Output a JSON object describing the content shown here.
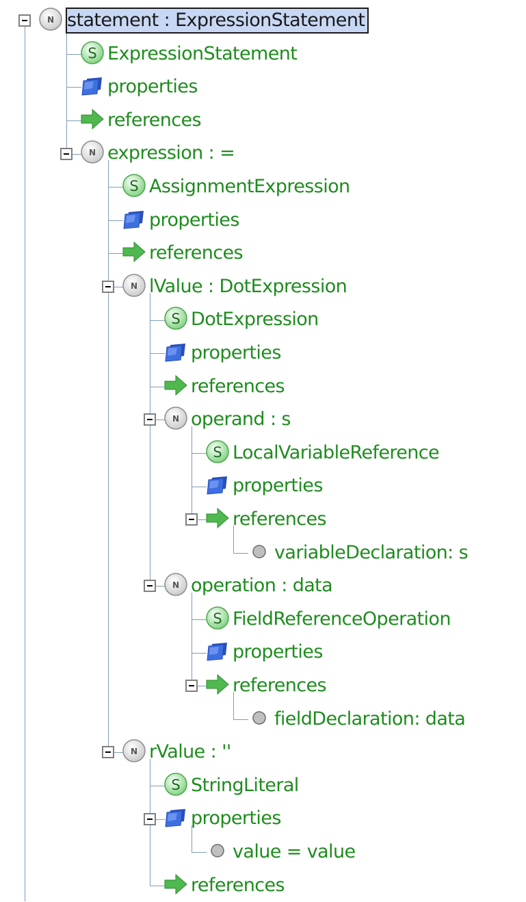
{
  "tree": {
    "nodes": [
      {
        "label": "statement : ExpressionStatement",
        "icon": "node-icon",
        "depth": 0,
        "expanded": true,
        "selected": true
      },
      {
        "label": "ExpressionStatement",
        "icon": "concept-icon",
        "depth": 1
      },
      {
        "label": "properties",
        "icon": "properties-icon",
        "depth": 1
      },
      {
        "label": "references",
        "icon": "references-arrow-icon",
        "depth": 1
      },
      {
        "label": "expression : =",
        "icon": "node-icon",
        "depth": 1,
        "expanded": true
      },
      {
        "label": "AssignmentExpression",
        "icon": "concept-icon",
        "depth": 2
      },
      {
        "label": "properties",
        "icon": "properties-icon",
        "depth": 2
      },
      {
        "label": "references",
        "icon": "references-arrow-icon",
        "depth": 2
      },
      {
        "label": "lValue : DotExpression",
        "icon": "node-icon",
        "depth": 2,
        "expanded": true
      },
      {
        "label": "DotExpression",
        "icon": "concept-icon",
        "depth": 3
      },
      {
        "label": "properties",
        "icon": "properties-icon",
        "depth": 3
      },
      {
        "label": "references",
        "icon": "references-arrow-icon",
        "depth": 3
      },
      {
        "label": "operand : s",
        "icon": "node-icon",
        "depth": 3,
        "expanded": true
      },
      {
        "label": "LocalVariableReference",
        "icon": "concept-icon",
        "depth": 4
      },
      {
        "label": "properties",
        "icon": "properties-icon",
        "depth": 4
      },
      {
        "label": "references",
        "icon": "references-arrow-icon",
        "depth": 4,
        "expanded": true
      },
      {
        "label": "variableDeclaration: s",
        "icon": "bullet-icon",
        "depth": 5
      },
      {
        "label": "operation : data",
        "icon": "node-icon",
        "depth": 3,
        "expanded": true
      },
      {
        "label": "FieldReferenceOperation",
        "icon": "concept-icon",
        "depth": 4
      },
      {
        "label": "properties",
        "icon": "properties-icon",
        "depth": 4
      },
      {
        "label": "references",
        "icon": "references-arrow-icon",
        "depth": 4,
        "expanded": true
      },
      {
        "label": "fieldDeclaration: data",
        "icon": "bullet-icon",
        "depth": 5
      },
      {
        "label": "rValue : ''",
        "icon": "node-icon",
        "depth": 2,
        "expanded": true
      },
      {
        "label": "StringLiteral",
        "icon": "concept-icon",
        "depth": 3
      },
      {
        "label": "properties",
        "icon": "properties-icon",
        "depth": 3,
        "expanded": true
      },
      {
        "label": "value = value",
        "icon": "bullet-icon",
        "depth": 4
      },
      {
        "label": "references",
        "icon": "references-arrow-icon",
        "depth": 3
      }
    ]
  },
  "icon_glyphs": {
    "node": "N",
    "concept": "S"
  },
  "colors": {
    "label_text": "#1e8c1e",
    "selected_background": "#c8d8f4",
    "tree_line": "#7f9db9",
    "concept_icon": "#7bd07b",
    "properties_icon": "#3d6fe0",
    "references_arrow": "#4fb84f",
    "node_icon": "#c8c8c8"
  }
}
